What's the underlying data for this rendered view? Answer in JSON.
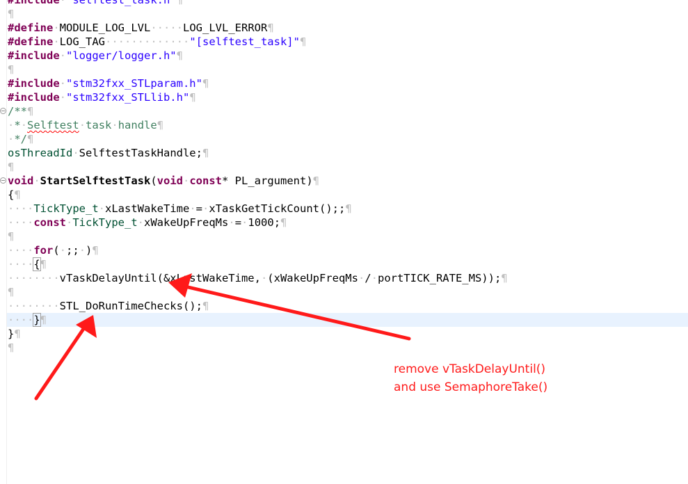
{
  "code_lines": {
    "l0": {
      "kw": "#include",
      "str": "\"selftest_task.h\""
    },
    "l2": {
      "kw": "#define",
      "name": "MODULE_LOG_LVL",
      "value": "LOG_LVL_ERROR"
    },
    "l3": {
      "kw": "#define",
      "name": "LOG_TAG",
      "value": "\"[selftest_task]\""
    },
    "l4": {
      "kw": "#include",
      "str": "\"logger/logger.h\""
    },
    "l6": {
      "kw": "#include",
      "str": "\"stm32fxx_STLparam.h\""
    },
    "l7": {
      "kw": "#include",
      "str": "\"stm32fxx_STLlib.h\""
    },
    "l8": {
      "text": "/**"
    },
    "l9": {
      "star": "*",
      "w1": "Selftest",
      "w2": "task",
      "w3": "handle"
    },
    "l10": {
      "text": "*/"
    },
    "l11": {
      "type": "osThreadId",
      "rest": "SelftestTaskHandle;"
    },
    "l13": {
      "kw1": "void",
      "fn": "StartSelftestTask",
      "open": "(",
      "kw2": "void",
      "kw3": "const",
      "rest": "* PL_argument)"
    },
    "l14": {
      "text": "{"
    },
    "l15": {
      "type": "TickType_t",
      "var": "xLastWakeTime",
      "eq": "=",
      "rest": "xTaskGetTickCount();;"
    },
    "l16": {
      "kw": "const",
      "type": "TickType_t",
      "var": "xWakeUpFreqMs",
      "eq": "=",
      "rest": "1000;"
    },
    "l18": {
      "kw": "for",
      "open": "(",
      "mid": ";;",
      "close": ")"
    },
    "l19": {
      "text": "{"
    },
    "l20": {
      "a": "vTaskDelayUntil(&xLastWakeTime,",
      "b": "(xWakeUpFreqMs",
      "c": "/",
      "d": "portTICK_RATE_MS));"
    },
    "l22": {
      "text": "STL_DoRunTimeChecks();"
    },
    "l23": {
      "text": "}"
    },
    "l24": {
      "text": "}"
    }
  },
  "pilcrow": "¶",
  "annotation": {
    "line1": "remove vTaskDelayUntil()",
    "line2": "and use SemaphoreTake()",
    "color": "#ff1a1a"
  },
  "colors": {
    "keyword": "#7f0055",
    "string": "#2a00ff",
    "comment": "#3f7f5f",
    "type": "#005032",
    "current_line": "#e8f2fe"
  },
  "icons": [
    "fold-toggle-icon",
    "arrow-icon"
  ]
}
